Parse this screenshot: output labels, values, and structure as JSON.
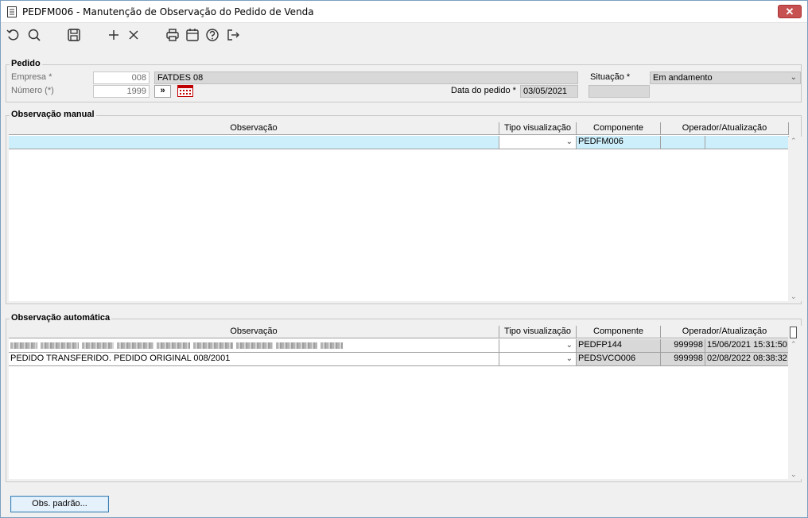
{
  "window": {
    "title": "PEDFM006 - Manutenção de Observação do Pedido de Venda",
    "close_glyph": "✕"
  },
  "toolbar": {
    "icons": [
      "refresh-icon",
      "search-icon",
      "save-icon",
      "add-icon",
      "delete-icon",
      "print-icon",
      "calendar-icon",
      "help-icon",
      "exit-icon"
    ]
  },
  "pedido": {
    "legend": "Pedido",
    "empresa_label": "Empresa *",
    "empresa_code": "008",
    "empresa_name": "FATDES 08",
    "numero_label": "Número (*)",
    "numero_value": "1999",
    "nav_glyph": "»",
    "data_label": "Data do pedido *",
    "data_value": "03/05/2021",
    "situacao_label": "Situação *",
    "situacao_value": "Em andamento"
  },
  "obs_manual": {
    "legend": "Observação manual",
    "columns": [
      "Observação",
      "Tipo visualização",
      "Componente",
      "Operador/Atualização"
    ],
    "rows": [
      {
        "observacao": "",
        "tipo": "",
        "componente": "PEDFM006",
        "operador": "",
        "atualizacao": ""
      }
    ]
  },
  "obs_auto": {
    "legend": "Observação automática",
    "columns": [
      "Observação",
      "Tipo visualização",
      "Componente",
      "Operador/Atualização"
    ],
    "rows": [
      {
        "observacao": "",
        "tipo": "",
        "componente": "PEDFP144",
        "operador": "999998",
        "atualizacao": "15/06/2021 15:31:50"
      },
      {
        "observacao": "PEDIDO TRANSFERIDO. PEDIDO ORIGINAL 008/2001",
        "tipo": "",
        "componente": "PEDSVCO006",
        "operador": "999998",
        "atualizacao": "02/08/2022 08:38:32"
      }
    ]
  },
  "buttons": {
    "obs_padrao": "Obs. padrão..."
  },
  "colors": {
    "selected_row": "#cdeffb",
    "window_bg": "#f0f0f0"
  }
}
